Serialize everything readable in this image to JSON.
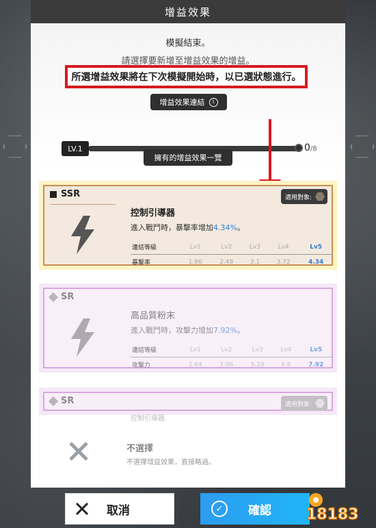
{
  "dialog": {
    "title": "增益效果",
    "message_line1": "模擬結束。",
    "message_line2": "請選擇要新增至增益效果的增益。",
    "highlight_message": "所選增益效果將在下次模擬開始時，以已選狀態進行。",
    "chain_label": "增益效果連結",
    "chain_level_badge": "LV.1",
    "chain_progress": {
      "current": "0",
      "max": "/8",
      "fraction": 0
    },
    "owned_label": "擁有的增益效果一覽"
  },
  "buffs": [
    {
      "rarity": "SSR",
      "target_label": "適用對象:",
      "name": "控制引導器",
      "desc_prefix": "進入戰鬥時，暴擊率增加",
      "desc_value": "4.34%",
      "desc_suffix": "。",
      "table_header": [
        "連結等級",
        "Lv1",
        "Lv2",
        "Lv3",
        "Lv4",
        "Lv5"
      ],
      "table_row": [
        "暴擊率",
        "1.86",
        "2.48",
        "3.1",
        "3.72",
        "4.34"
      ]
    },
    {
      "rarity": "SR",
      "name": "高品質粉末",
      "desc_prefix": "進入戰鬥時，攻擊力增加",
      "desc_value": "7.92%",
      "desc_suffix": "。",
      "table_header": [
        "連結等級",
        "Lv1",
        "Lv2",
        "Lv3",
        "Lv4",
        "Lv5"
      ],
      "table_row": [
        "攻擊力",
        "2.64",
        "3.96",
        "5.28",
        "6.6",
        "7.92"
      ]
    },
    {
      "rarity": "SR",
      "target_label": "適用對象:",
      "name": "控制引導器"
    }
  ],
  "none_option": {
    "title": "不選擇",
    "desc": "不選擇增益效果，直接略過。"
  },
  "buttons": {
    "cancel": "取消",
    "confirm": "確認"
  },
  "watermark": "18183",
  "colors": {
    "highlight_border": "#d71920",
    "accent_blue": "#2f7fd8",
    "confirm_bg": "#2d9cf0"
  }
}
